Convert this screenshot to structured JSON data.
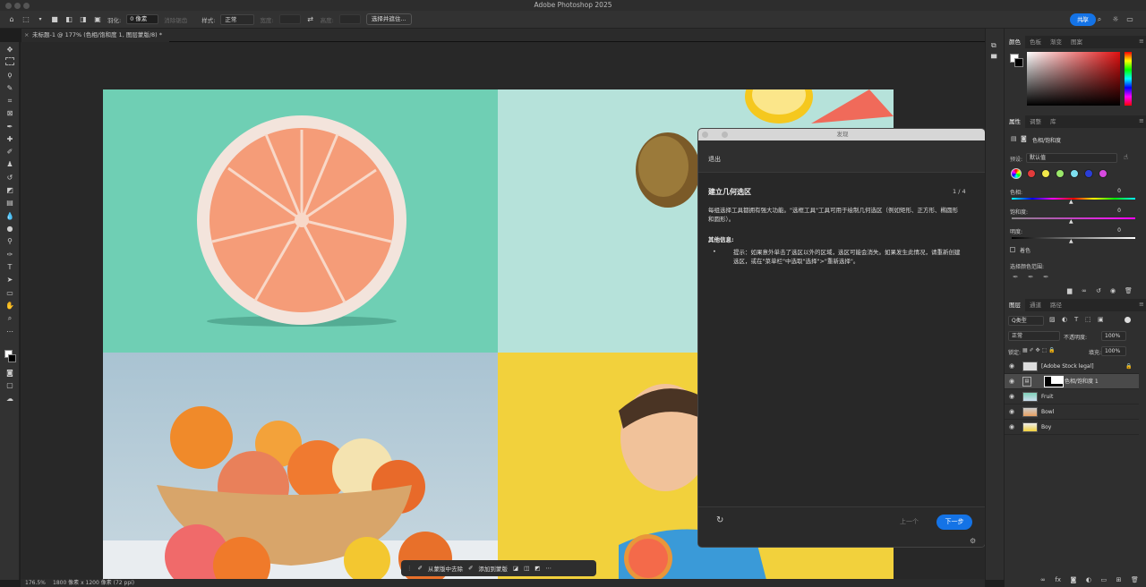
{
  "app": {
    "title": "Adobe Photoshop 2025"
  },
  "options": {
    "feather_label": "羽化:",
    "feather_value": "0 像素",
    "antialias": "消除锯齿",
    "style_label": "样式:",
    "style_value": "正常",
    "width_label": "宽度:",
    "height_label": "高度:",
    "select_mask": "选择并遮住...",
    "share": "共享"
  },
  "document": {
    "tab": "未标题-1 @ 177% (色相/饱和度 1, 图层蒙版/8) *"
  },
  "status": {
    "zoom": "176.5%",
    "size": "1800 像素 x 1200 像素 (72 ppi)"
  },
  "floatbar": {
    "remove": "从蒙版中去除",
    "add": "添加到蒙版"
  },
  "dialog": {
    "title": "发现",
    "exit": "退出",
    "heading": "建立几何选区",
    "step": "1 / 4",
    "body": "每组选择工具都拥有强大功能。\"选框工具\"工具可用于绘制几何选区（例如矩形、正方形、椭圆形和圆形）。",
    "more_label": "其他信息:",
    "bullet": "提示：如果意外单击了选区以外的区域，选区可能会消失。如果发生此情况，请重新创建选区，或在\"菜单栏\"中选取\"选择\">\"重新选择\"。",
    "prev": "上一个",
    "next": "下一步"
  },
  "color_panel": {
    "tabs": [
      "颜色",
      "色板",
      "渐变",
      "图案"
    ]
  },
  "properties": {
    "tabs": [
      "属性",
      "调整",
      "库"
    ],
    "adj_name": "色相/饱和度",
    "preset_label": "预设:",
    "preset_value": "默认值",
    "hue_label": "色相:",
    "hue_value": "0",
    "sat_label": "饱和度:",
    "sat_value": "0",
    "light_label": "明度:",
    "light_value": "0",
    "colorize": "着色",
    "range_label": "选择颜色范围:"
  },
  "swatch_colors": [
    "#e23b3b",
    "#f2e84a",
    "#9be86a",
    "#7ee0f0",
    "#2a3ed8",
    "#d84ae0"
  ],
  "layers_panel": {
    "tabs": [
      "图层",
      "通道",
      "路径"
    ],
    "kind": "Q类型",
    "blend": "正常",
    "opacity_label": "不透明度:",
    "opacity_value": "100%",
    "lock_label": "锁定:",
    "fill_label": "填充:",
    "fill_value": "100%",
    "layers": [
      {
        "name": "[Adobe Stock legal]"
      },
      {
        "name": "色相/饱和度 1"
      },
      {
        "name": "Fruit"
      },
      {
        "name": "Bowl"
      },
      {
        "name": "Boy"
      }
    ]
  }
}
